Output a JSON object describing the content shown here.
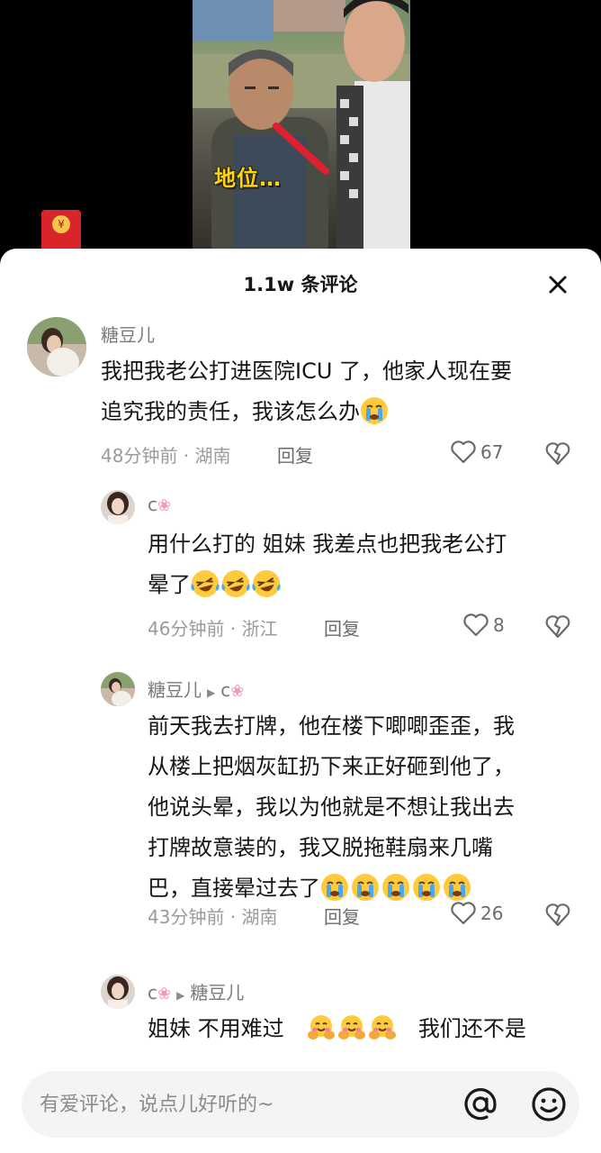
{
  "video": {
    "caption": "地位…"
  },
  "sheet": {
    "title": "1.1w 条评论"
  },
  "comments": [
    {
      "user": "糖豆儿",
      "text_line1": "我把我老公打进医院ICU 了，他家人现在要",
      "text_line2": "追究我的责任，我该怎么办",
      "time_location": "48分钟前 · 湖南",
      "reply_label": "回复",
      "likes": "67"
    },
    {
      "user": "c",
      "text_line1": "用什么打的 姐妹  我差点也把我老公打",
      "text_line2": "晕了",
      "time_location": "46分钟前 · 浙江",
      "reply_label": "回复",
      "likes": "8"
    },
    {
      "user": "糖豆儿",
      "reply_to": "c",
      "text_line1": "前天我去打牌，他在楼下唧唧歪歪，我",
      "text_line2": "从楼上把烟灰缸扔下来正好砸到他了，",
      "text_line3": "他说头晕，我以为他就是不想让我出去",
      "text_line4": "打牌故意装的，我又脱拖鞋扇来几嘴",
      "text_line5": "巴，直接晕过去了",
      "time_location": "43分钟前 · 湖南",
      "reply_label": "回复",
      "likes": "26"
    },
    {
      "user": "c",
      "reply_to": "糖豆儿",
      "text_part1": "姐妹  不用难过",
      "text_part2": "我们还不是"
    }
  ],
  "input": {
    "placeholder": "有爱评论，说点儿好听的~"
  },
  "icons": {
    "close": "close-icon",
    "like": "heart-outline-icon",
    "dislike": "broken-heart-icon",
    "at": "at-sign-icon",
    "emoji": "smiley-icon",
    "cry_emoji": "crying-face-emoji",
    "laugh_emoji": "tears-of-joy-emoji",
    "hug_emoji": "hugging-face-emoji",
    "flower": "cherry-blossom-icon"
  },
  "colors": {
    "sheet_bg": "#ffffff",
    "caption": "#ffd400",
    "meta_text": "#9b9b9b",
    "username": "#7a7a7a"
  }
}
